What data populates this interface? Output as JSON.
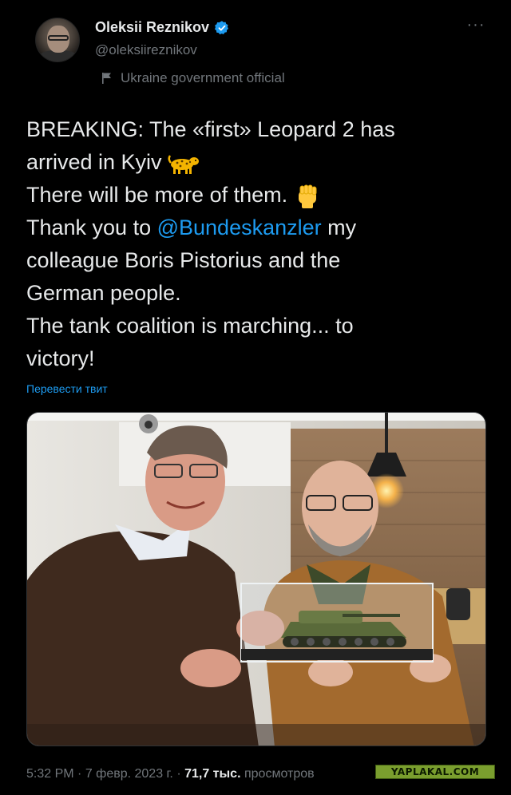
{
  "author": {
    "display_name": "Oleksii Reznikov",
    "handle": "@oleksiireznikov",
    "affiliation": "Ukraine government official",
    "verified_badge_color": "#1d9bf0"
  },
  "tweet": {
    "lines": {
      "l1": "BREAKING: The «first» Leopard 2 has",
      "l2": "arrived in Kyiv",
      "l3": "There will be more of them.",
      "l4_pre": "Thank you to ",
      "l4_mention": "@Bundeskanzler",
      "l4_post": " my",
      "l5": "colleague Boris Pistorius and the",
      "l6": "German people.",
      "l7": "The tank coalition is marching... to",
      "l8": "victory!"
    },
    "emojis": {
      "leopard": "leopard-emoji",
      "fist": "raised-fist-emoji"
    },
    "translate_label": "Перевести твит"
  },
  "meta": {
    "time": "5:32 PM",
    "sep1": " · ",
    "date": "7 февр. 2023 г.",
    "sep2": " · ",
    "views_count": "71,7 тыс.",
    "views_label": " просмотров"
  },
  "watermark": "YAPLAKAL.COM",
  "colors": {
    "background": "#000000",
    "text": "#e7e9ea",
    "secondary": "#71767b",
    "link": "#1d9bf0"
  }
}
